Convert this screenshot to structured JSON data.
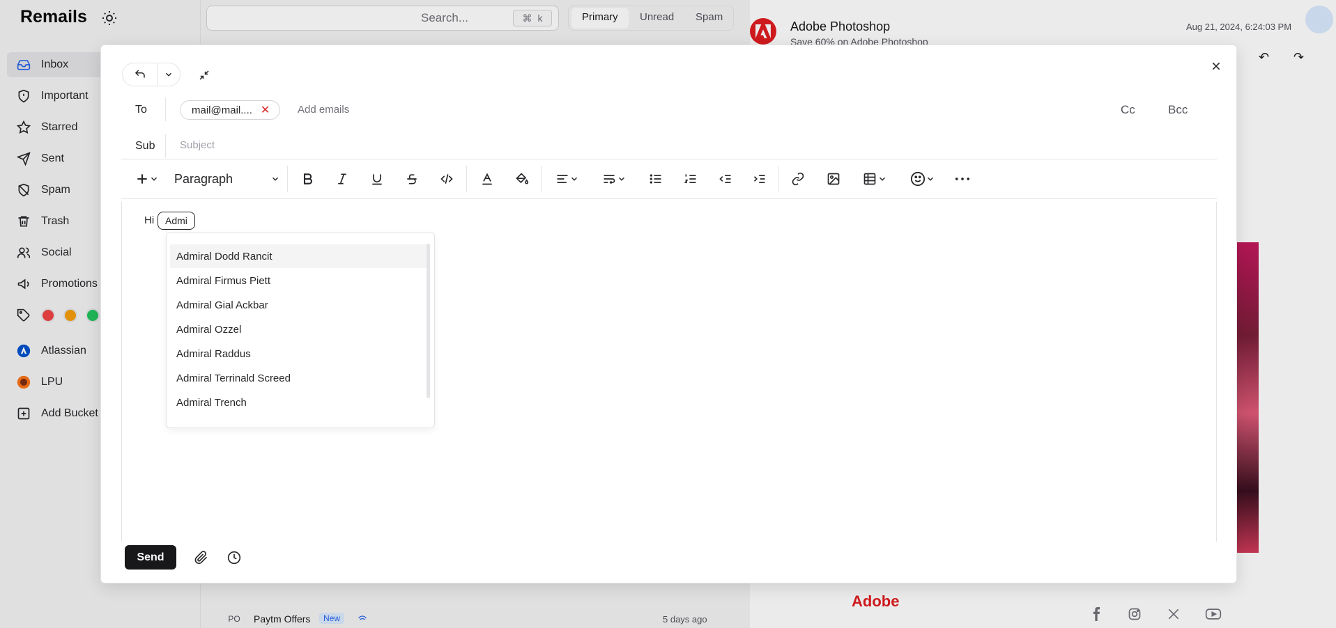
{
  "app": {
    "brand": "Remails",
    "search_placeholder": "Search...",
    "search_shortcut_key": "k",
    "tabs": [
      "Primary",
      "Unread",
      "Spam"
    ],
    "active_tab": "Primary"
  },
  "sidebar": {
    "items": [
      {
        "label": "Inbox",
        "icon": "inbox-icon",
        "active": true
      },
      {
        "label": "Important",
        "icon": "shield-icon"
      },
      {
        "label": "Starred",
        "icon": "star-icon"
      },
      {
        "label": "Sent",
        "icon": "send-icon"
      },
      {
        "label": "Spam",
        "icon": "spam-icon"
      },
      {
        "label": "Trash",
        "icon": "trash-icon"
      },
      {
        "label": "Social",
        "icon": "users-icon"
      },
      {
        "label": "Promotions",
        "icon": "megaphone-icon"
      }
    ],
    "tag_colors": [
      "#ef4444",
      "#f59e0b",
      "#22c55e"
    ],
    "buckets": [
      {
        "label": "Atlassian",
        "icon": "atlassian-icon"
      },
      {
        "label": "LPU",
        "icon": "lpu-icon"
      }
    ],
    "add_bucket": "Add Bucket"
  },
  "detail": {
    "sender": "Adobe Photoshop",
    "subject": "Save 60% on Adobe Photoshop",
    "date": "Aug 21, 2024, 6:24:03 PM",
    "footer_logo": "Adobe",
    "social_icons": [
      "facebook-icon",
      "instagram-icon",
      "x-icon",
      "youtube-icon"
    ]
  },
  "list": {
    "row": {
      "badge": "PO",
      "sender": "Paytm Offers",
      "new_label": "New",
      "time": "5 days ago"
    }
  },
  "compose": {
    "to_label": "To",
    "recipient_chip": "mail@mail....",
    "add_emails_placeholder": "Add emails",
    "cc_label": "Cc",
    "bcc_label": "Bcc",
    "sub_label": "Sub",
    "subject_placeholder": "Subject",
    "block_type": "Paragraph",
    "body_prefix": "Hi",
    "mention_query": "Admi",
    "suggestions": [
      "Admiral Dodd Rancit",
      "Admiral Firmus Piett",
      "Admiral Gial Ackbar",
      "Admiral Ozzel",
      "Admiral Raddus",
      "Admiral Terrinald Screed",
      "Admiral Trench"
    ],
    "send_label": "Send"
  },
  "colors": {
    "accent": "#2563eb",
    "brand_red": "#e11d20",
    "send_bg": "#18181b"
  }
}
